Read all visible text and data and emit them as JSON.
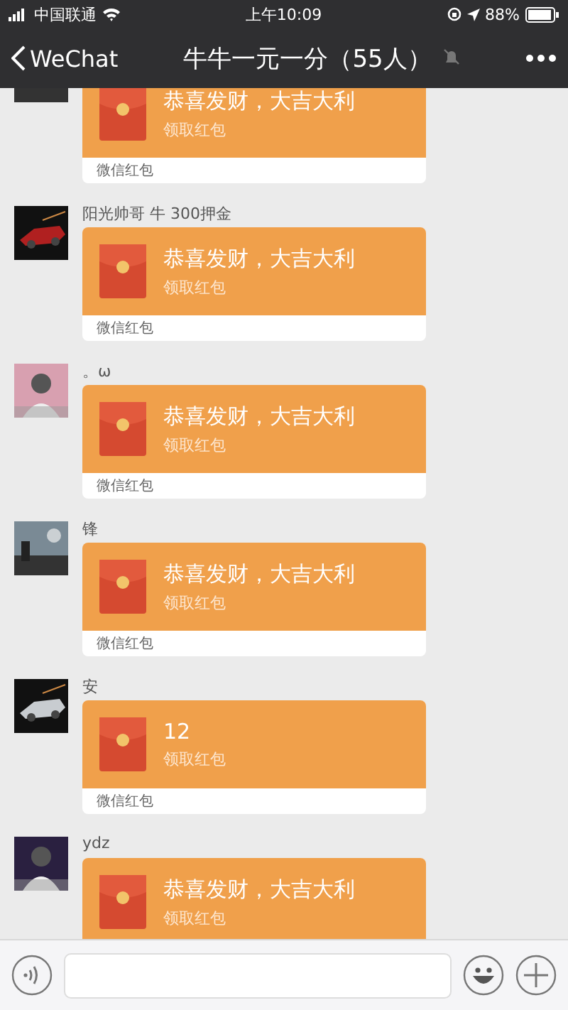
{
  "status_bar": {
    "carrier": "中国联通",
    "time": "上午10:09",
    "battery": "88%"
  },
  "nav": {
    "back": "WeChat",
    "title": "牛牛一元一分（55人）",
    "muted": true
  },
  "messages": [
    {
      "title": "恭喜发财，大吉大利",
      "action": "领取红包",
      "footer": "微信红包"
    },
    {
      "sender": "阳光帅哥 牛 300押金",
      "title": "恭喜发财，大吉大利",
      "action": "领取红包",
      "footer": "微信红包"
    },
    {
      "sender": "。ω",
      "title": "恭喜发财，大吉大利",
      "action": "领取红包",
      "footer": "微信红包"
    },
    {
      "sender": "锋",
      "title": "恭喜发财，大吉大利",
      "action": "领取红包",
      "footer": "微信红包"
    },
    {
      "sender": "安",
      "title": "12",
      "action": "领取红包",
      "footer": "微信红包"
    },
    {
      "sender": "ydz",
      "title": "恭喜发财，大吉大利",
      "action": "领取红包"
    }
  ]
}
